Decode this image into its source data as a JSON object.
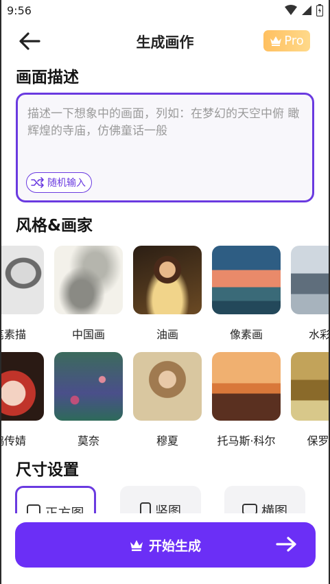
{
  "status": {
    "time": "9:56"
  },
  "header": {
    "title": "生成画作",
    "pro_label": "Pro"
  },
  "description": {
    "section_title": "画面描述",
    "placeholder": "描述一下想象中的画面，列如：在梦幻的天空中俯 瞰辉煌的寺庙，仿佛童话一般",
    "random_label": "随机输入"
  },
  "styles": {
    "section_title": "风格&画家",
    "row1": [
      "笔素描",
      "中国画",
      "油画",
      "像素画",
      "水彩绘"
    ],
    "row2": [
      "鸦传婧",
      "莫奈",
      "穆夏",
      "托马斯·科尔",
      "保罗·塞"
    ]
  },
  "size": {
    "section_title": "尺寸设置",
    "options": [
      "正方图",
      "竖图",
      "横图"
    ],
    "selected": "正方图"
  },
  "action": {
    "start_label": "开始生成"
  },
  "colors": {
    "accent": "#6b2ff6",
    "pro": "#ffc060"
  }
}
